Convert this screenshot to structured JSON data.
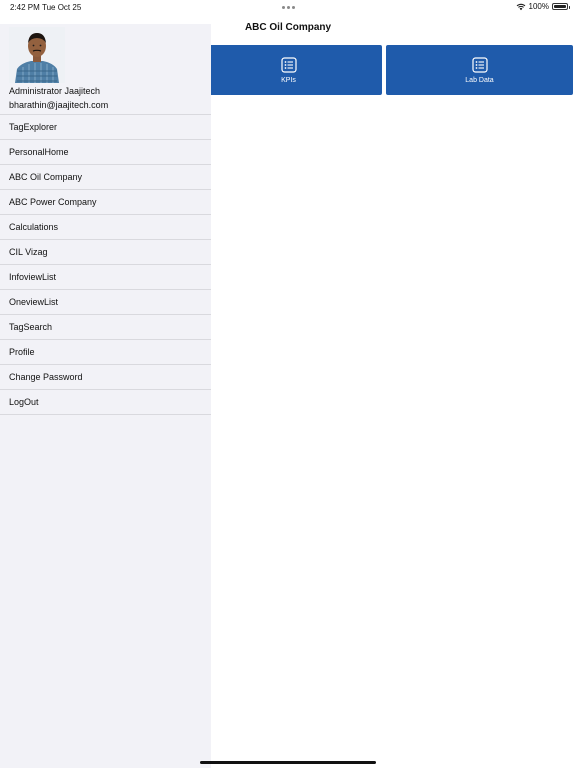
{
  "status_bar": {
    "time": "2:42 PM",
    "date": "Tue Oct 25",
    "battery": "100%",
    "icons": [
      "wifi-icon",
      "battery-icon"
    ]
  },
  "header": {
    "title": "ABC Oil Company"
  },
  "tiles": [
    {
      "label": "KPIs",
      "icon": "list-icon"
    },
    {
      "label": "Lab Data",
      "icon": "list-icon"
    }
  ],
  "drawer": {
    "avatar_icon": "user-avatar",
    "user_name": "Administrator Jaajitech",
    "user_email": "bharathin@jaajitech.com",
    "menu": [
      "TagExplorer",
      "PersonalHome",
      "ABC Oil Company",
      "ABC Power Company",
      "Calculations",
      "CIL Vizag",
      "InfoviewList",
      "OneviewList",
      "TagSearch",
      "Profile",
      "Change Password",
      "LogOut"
    ]
  },
  "colors": {
    "tile_background": "#1f5bab",
    "drawer_background": "#f2f2f7",
    "divider": "#d9d9de"
  }
}
